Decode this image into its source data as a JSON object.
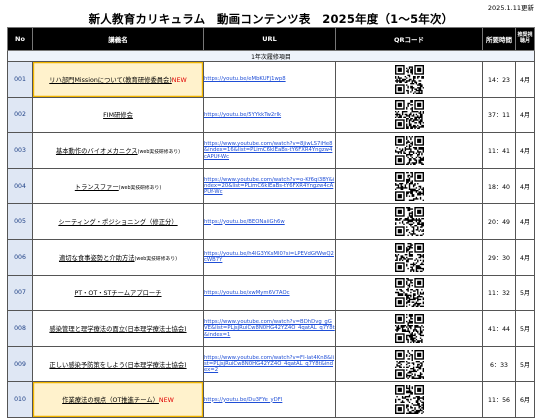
{
  "header": {
    "updated": "2025.1.11更新",
    "title": "新人教育カリキュラム　動画コンテンツ表　2025年度（1～5年次）"
  },
  "columns": {
    "no": "No",
    "title": "講義名",
    "url": "URL",
    "qr": "QRコード",
    "time": "所要時間",
    "month": "推奨視聴月"
  },
  "section": "1年次履修項目",
  "rows": [
    {
      "no": "001",
      "title": "リハ部門Missionについて(教育研修委員会)",
      "sub": "",
      "new": "NEW",
      "url": "https://youtu.be/eMbKUFj1wp8",
      "time": "14：23",
      "month": "4月",
      "highlight": true
    },
    {
      "no": "002",
      "title": "FIM研修会",
      "sub": "",
      "new": "",
      "url": "https://youtu.be/5YYkkTw2rIk",
      "time": "37：11",
      "month": "4月",
      "highlight": false
    },
    {
      "no": "003",
      "title": "基本動作のバイオメカニクス",
      "sub": "(web実技研修あり)",
      "new": "",
      "url": "https://www.youtube.com/watch?v=8jiwLS7iHe8&index=16&list=PLimC6kIEaBs-tY6FXR4Yngzw4cAPUf-Wc",
      "time": "11：41",
      "month": "4月",
      "highlight": false
    },
    {
      "no": "004",
      "title": "トランスファー",
      "sub": "(web実技研修あり)",
      "new": "",
      "url": "https://www.youtube.com/watch?v=o-Kf6qi3BY&index=20&list=PLimC6kIEaBs-tY6FXR4Yngzw4cAPUf-Wc",
      "time": "18：40",
      "month": "4月",
      "highlight": false
    },
    {
      "no": "005",
      "title": "シーティング・ポジショニング（修正分）",
      "sub": "",
      "new": "",
      "url": "https://youtu.be/BEONaiiGh6w",
      "time": "20：49",
      "month": "4月",
      "highlight": false
    },
    {
      "no": "006",
      "title": "適切な食事姿勢と介助方法",
      "sub": "(web実技研修あり)",
      "new": "",
      "url": "https://youtu.be/h4lG3YKsMI0?si=LPEVdGfWwQ2cWB7Y",
      "time": "29：30",
      "month": "4月",
      "highlight": false
    },
    {
      "no": "007",
      "title": "PT・OT・STチームアプローチ",
      "sub": "",
      "new": "",
      "url": "https://youtu.be/xwMym6V7AOc",
      "time": "11：32",
      "month": "5月",
      "highlight": false
    },
    {
      "no": "008",
      "title": "感染管理と理学療法の面立(日本理学療法士協会)",
      "sub": "",
      "new": "",
      "url": "https://www.youtube.com/watch?v=BDhDvg_gGVE&list=PLjsjRuiCw8N0HG42YZ4O_4qatAL_q7Y8t&index=1",
      "time": "41：44",
      "month": "5月",
      "highlight": false
    },
    {
      "no": "009",
      "title": "正しい感染予防策をしよう(日本理学療法士協会)",
      "sub": "",
      "new": "",
      "url": "https://www.youtube.com/watch?v=FI-lat4Kn8&list=PLjsjRuiCw8N0HG42YZ4O_4qatAL_q7Y8t&index=2",
      "time": "6：33",
      "month": "5月",
      "highlight": false
    },
    {
      "no": "010",
      "title": "作業療法の視点（OT推進チーム）",
      "sub": "",
      "new": "NEW",
      "url": "https://youtu.be/Du3FYe_yDFI",
      "time": "11：56",
      "month": "6月",
      "highlight": true
    }
  ]
}
